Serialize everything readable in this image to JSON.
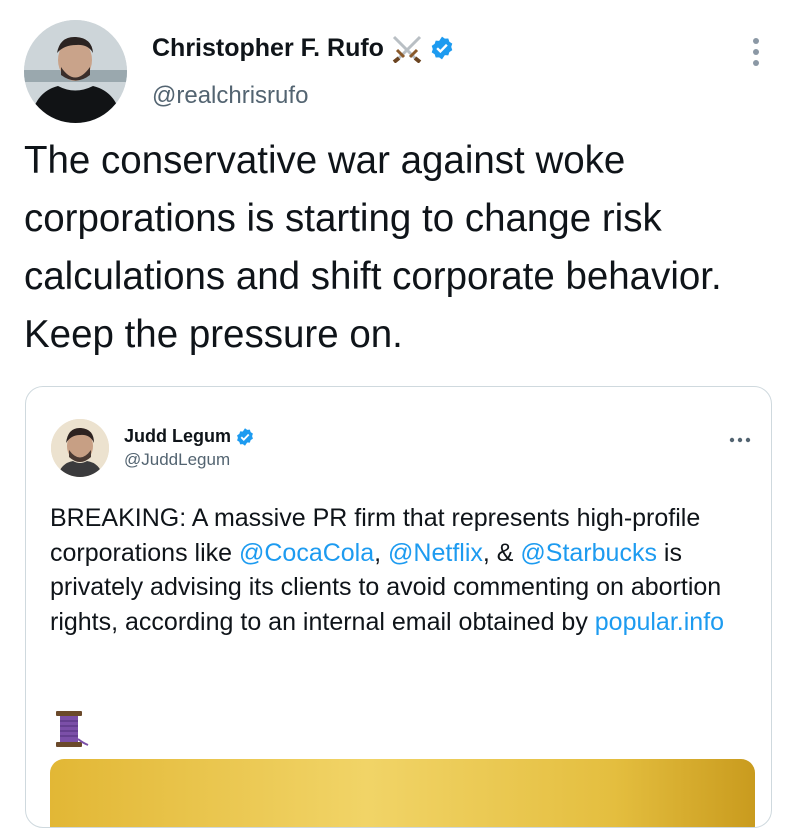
{
  "tweet": {
    "author_name": "Christopher F. Rufo",
    "author_handle": "@realchrisrufo",
    "text": "The conservative war against woke corporations is starting to change risk calculations and shift corporate behavior. Keep the pressure on."
  },
  "quote": {
    "thread_label": "Thread",
    "author_name": "Judd Legum",
    "author_handle": "@JuddLegum",
    "text_1": "BREAKING: A massive PR firm that represents high-profile corporations like ",
    "mention_1": "@CocaCola",
    "sep_1": ", ",
    "mention_2": "@Netflix",
    "sep_2": ", & ",
    "mention_3": "@Starbucks",
    "text_2": " is privately advising its clients to avoid commenting on abortion rights, according to an internal email obtained by ",
    "link": "popular.info"
  },
  "icons": [
    "crossed-swords-icon",
    "verified-badge-icon",
    "more-options-icon",
    "spool-of-thread-icon"
  ],
  "colors": {
    "link": "#1d9bf0",
    "verified": "#1d9bf0",
    "secondary_text": "#536471",
    "banner": "#e9c548"
  }
}
